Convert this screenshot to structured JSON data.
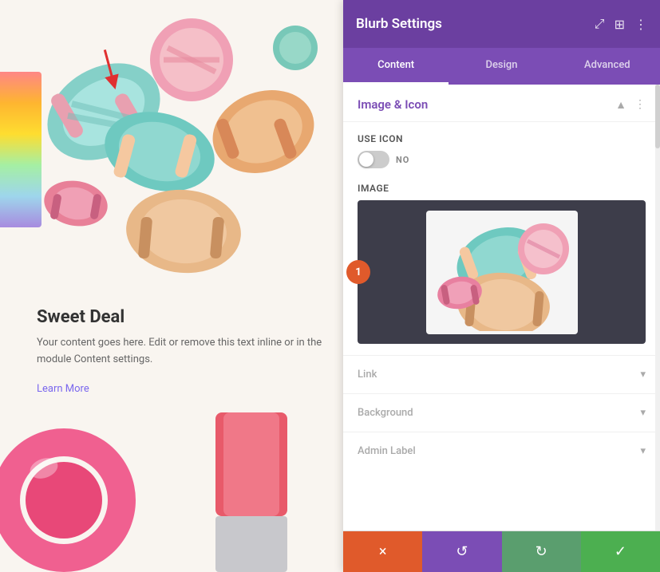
{
  "page": {
    "left_panel": {
      "title_text": "Sweet Deal",
      "body_text": "Your content goes here. Edit or remove this text inline or in the module Content settings.",
      "link_text": "Learn More"
    },
    "settings_panel": {
      "header": {
        "title": "Blurb Settings",
        "icons": [
          "expand-icon",
          "columns-icon",
          "more-icon"
        ]
      },
      "tabs": [
        {
          "label": "Content",
          "active": true
        },
        {
          "label": "Design",
          "active": false
        },
        {
          "label": "Advanced",
          "active": false
        }
      ],
      "sections": {
        "image_icon": {
          "title": "Image & Icon",
          "use_icon_label": "Use Icon",
          "toggle_state": "NO",
          "image_label": "Image",
          "step_number": "1"
        },
        "link": {
          "label": "Link"
        },
        "background": {
          "label": "Background"
        },
        "admin_label": {
          "label": "Admin Label"
        }
      },
      "bottom_bar": {
        "cancel_icon": "×",
        "undo_icon": "↺",
        "redo_icon": "↻",
        "save_icon": "✓"
      }
    }
  }
}
